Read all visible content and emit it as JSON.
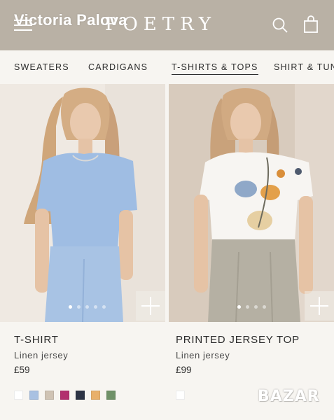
{
  "header": {
    "brand": "POETRY",
    "seller_name": "Victoria Palova",
    "icons": [
      "menu-icon",
      "search-icon",
      "bag-icon"
    ],
    "background": "#b9b1a5"
  },
  "nav": {
    "categories": [
      {
        "label": "SWEATERS",
        "active": false
      },
      {
        "label": "CARDIGANS",
        "active": false
      },
      {
        "label": "T-SHIRTS & TOPS",
        "active": true
      },
      {
        "label": "SHIRT & TUNI",
        "active": false
      }
    ]
  },
  "products": [
    {
      "name": "T-SHIRT",
      "fabric": "Linen jersey",
      "price": "£59",
      "image_slides": 5,
      "active_slide": 0,
      "swatches": [
        "#ffffff",
        "#a9c1e2",
        "#cfc3b4",
        "#b22f6e",
        "#2c3344",
        "#e8b06b",
        "#6f9168"
      ]
    },
    {
      "name": "PRINTED JERSEY TOP",
      "fabric": "Linen jersey",
      "price": "£99",
      "image_slides": 4,
      "active_slide": 0,
      "swatches": [
        "#ffffff"
      ]
    }
  ],
  "watermark": "BAZAR"
}
